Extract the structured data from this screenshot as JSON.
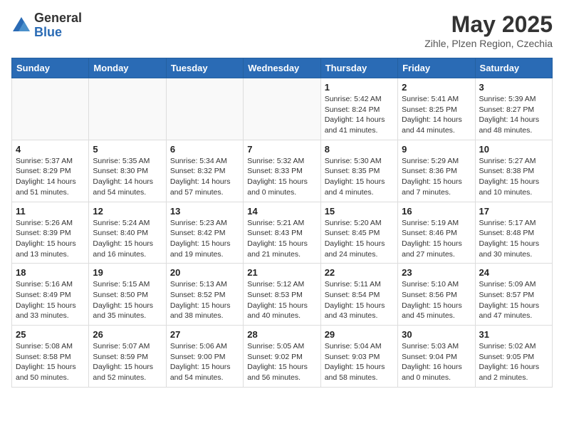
{
  "header": {
    "logo_general": "General",
    "logo_blue": "Blue",
    "month_title": "May 2025",
    "subtitle": "Zihle, Plzen Region, Czechia"
  },
  "days_of_week": [
    "Sunday",
    "Monday",
    "Tuesday",
    "Wednesday",
    "Thursday",
    "Friday",
    "Saturday"
  ],
  "weeks": [
    [
      {
        "day": "",
        "info": ""
      },
      {
        "day": "",
        "info": ""
      },
      {
        "day": "",
        "info": ""
      },
      {
        "day": "",
        "info": ""
      },
      {
        "day": "1",
        "info": "Sunrise: 5:42 AM\nSunset: 8:24 PM\nDaylight: 14 hours\nand 41 minutes."
      },
      {
        "day": "2",
        "info": "Sunrise: 5:41 AM\nSunset: 8:25 PM\nDaylight: 14 hours\nand 44 minutes."
      },
      {
        "day": "3",
        "info": "Sunrise: 5:39 AM\nSunset: 8:27 PM\nDaylight: 14 hours\nand 48 minutes."
      }
    ],
    [
      {
        "day": "4",
        "info": "Sunrise: 5:37 AM\nSunset: 8:29 PM\nDaylight: 14 hours\nand 51 minutes."
      },
      {
        "day": "5",
        "info": "Sunrise: 5:35 AM\nSunset: 8:30 PM\nDaylight: 14 hours\nand 54 minutes."
      },
      {
        "day": "6",
        "info": "Sunrise: 5:34 AM\nSunset: 8:32 PM\nDaylight: 14 hours\nand 57 minutes."
      },
      {
        "day": "7",
        "info": "Sunrise: 5:32 AM\nSunset: 8:33 PM\nDaylight: 15 hours\nand 0 minutes."
      },
      {
        "day": "8",
        "info": "Sunrise: 5:30 AM\nSunset: 8:35 PM\nDaylight: 15 hours\nand 4 minutes."
      },
      {
        "day": "9",
        "info": "Sunrise: 5:29 AM\nSunset: 8:36 PM\nDaylight: 15 hours\nand 7 minutes."
      },
      {
        "day": "10",
        "info": "Sunrise: 5:27 AM\nSunset: 8:38 PM\nDaylight: 15 hours\nand 10 minutes."
      }
    ],
    [
      {
        "day": "11",
        "info": "Sunrise: 5:26 AM\nSunset: 8:39 PM\nDaylight: 15 hours\nand 13 minutes."
      },
      {
        "day": "12",
        "info": "Sunrise: 5:24 AM\nSunset: 8:40 PM\nDaylight: 15 hours\nand 16 minutes."
      },
      {
        "day": "13",
        "info": "Sunrise: 5:23 AM\nSunset: 8:42 PM\nDaylight: 15 hours\nand 19 minutes."
      },
      {
        "day": "14",
        "info": "Sunrise: 5:21 AM\nSunset: 8:43 PM\nDaylight: 15 hours\nand 21 minutes."
      },
      {
        "day": "15",
        "info": "Sunrise: 5:20 AM\nSunset: 8:45 PM\nDaylight: 15 hours\nand 24 minutes."
      },
      {
        "day": "16",
        "info": "Sunrise: 5:19 AM\nSunset: 8:46 PM\nDaylight: 15 hours\nand 27 minutes."
      },
      {
        "day": "17",
        "info": "Sunrise: 5:17 AM\nSunset: 8:48 PM\nDaylight: 15 hours\nand 30 minutes."
      }
    ],
    [
      {
        "day": "18",
        "info": "Sunrise: 5:16 AM\nSunset: 8:49 PM\nDaylight: 15 hours\nand 33 minutes."
      },
      {
        "day": "19",
        "info": "Sunrise: 5:15 AM\nSunset: 8:50 PM\nDaylight: 15 hours\nand 35 minutes."
      },
      {
        "day": "20",
        "info": "Sunrise: 5:13 AM\nSunset: 8:52 PM\nDaylight: 15 hours\nand 38 minutes."
      },
      {
        "day": "21",
        "info": "Sunrise: 5:12 AM\nSunset: 8:53 PM\nDaylight: 15 hours\nand 40 minutes."
      },
      {
        "day": "22",
        "info": "Sunrise: 5:11 AM\nSunset: 8:54 PM\nDaylight: 15 hours\nand 43 minutes."
      },
      {
        "day": "23",
        "info": "Sunrise: 5:10 AM\nSunset: 8:56 PM\nDaylight: 15 hours\nand 45 minutes."
      },
      {
        "day": "24",
        "info": "Sunrise: 5:09 AM\nSunset: 8:57 PM\nDaylight: 15 hours\nand 47 minutes."
      }
    ],
    [
      {
        "day": "25",
        "info": "Sunrise: 5:08 AM\nSunset: 8:58 PM\nDaylight: 15 hours\nand 50 minutes."
      },
      {
        "day": "26",
        "info": "Sunrise: 5:07 AM\nSunset: 8:59 PM\nDaylight: 15 hours\nand 52 minutes."
      },
      {
        "day": "27",
        "info": "Sunrise: 5:06 AM\nSunset: 9:00 PM\nDaylight: 15 hours\nand 54 minutes."
      },
      {
        "day": "28",
        "info": "Sunrise: 5:05 AM\nSunset: 9:02 PM\nDaylight: 15 hours\nand 56 minutes."
      },
      {
        "day": "29",
        "info": "Sunrise: 5:04 AM\nSunset: 9:03 PM\nDaylight: 15 hours\nand 58 minutes."
      },
      {
        "day": "30",
        "info": "Sunrise: 5:03 AM\nSunset: 9:04 PM\nDaylight: 16 hours\nand 0 minutes."
      },
      {
        "day": "31",
        "info": "Sunrise: 5:02 AM\nSunset: 9:05 PM\nDaylight: 16 hours\nand 2 minutes."
      }
    ]
  ]
}
